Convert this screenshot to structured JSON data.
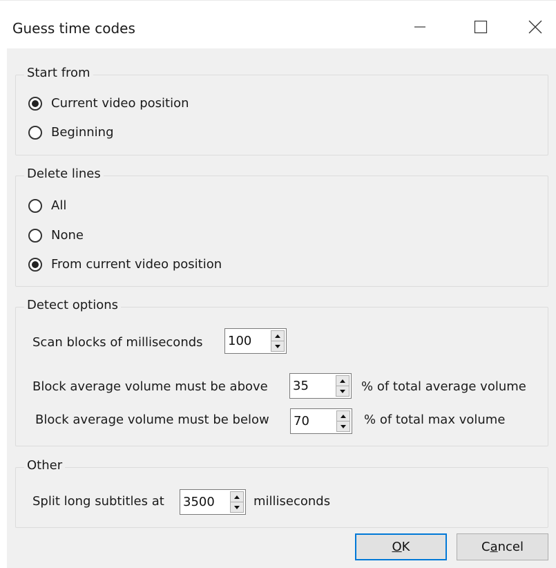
{
  "window": {
    "title": "Guess time codes",
    "controls": {
      "minimize_icon": "minimize-icon",
      "maximize_icon": "maximize-icon",
      "close_icon": "close-icon"
    }
  },
  "start_from": {
    "legend": "Start from",
    "options": [
      {
        "label": "Current video position",
        "checked": true
      },
      {
        "label": "Beginning",
        "checked": false
      }
    ]
  },
  "delete_lines": {
    "legend": "Delete lines",
    "options": [
      {
        "label": "All",
        "checked": false
      },
      {
        "label": "None",
        "checked": false
      },
      {
        "label": "From current video position",
        "checked": true
      }
    ]
  },
  "detect_options": {
    "legend": "Detect options",
    "scan_blocks": {
      "label": "Scan blocks of milliseconds",
      "value": "100"
    },
    "above": {
      "label": "Block average volume must be above",
      "value": "35",
      "suffix": "% of total average volume"
    },
    "below": {
      "label": "Block average volume must be below",
      "value": "70",
      "suffix": "% of total max volume"
    }
  },
  "other": {
    "legend": "Other",
    "split": {
      "label": "Split long subtitles at",
      "value": "3500",
      "suffix": "milliseconds"
    }
  },
  "buttons": {
    "ok": {
      "mnemonic": "O",
      "rest": "K"
    },
    "cancel": {
      "prefix": "C",
      "mnemonic": "a",
      "rest": "ncel"
    }
  },
  "colors": {
    "accent": "#0078d7",
    "client_bg": "#f0f0f0",
    "button_bg": "#e1e1e1"
  }
}
